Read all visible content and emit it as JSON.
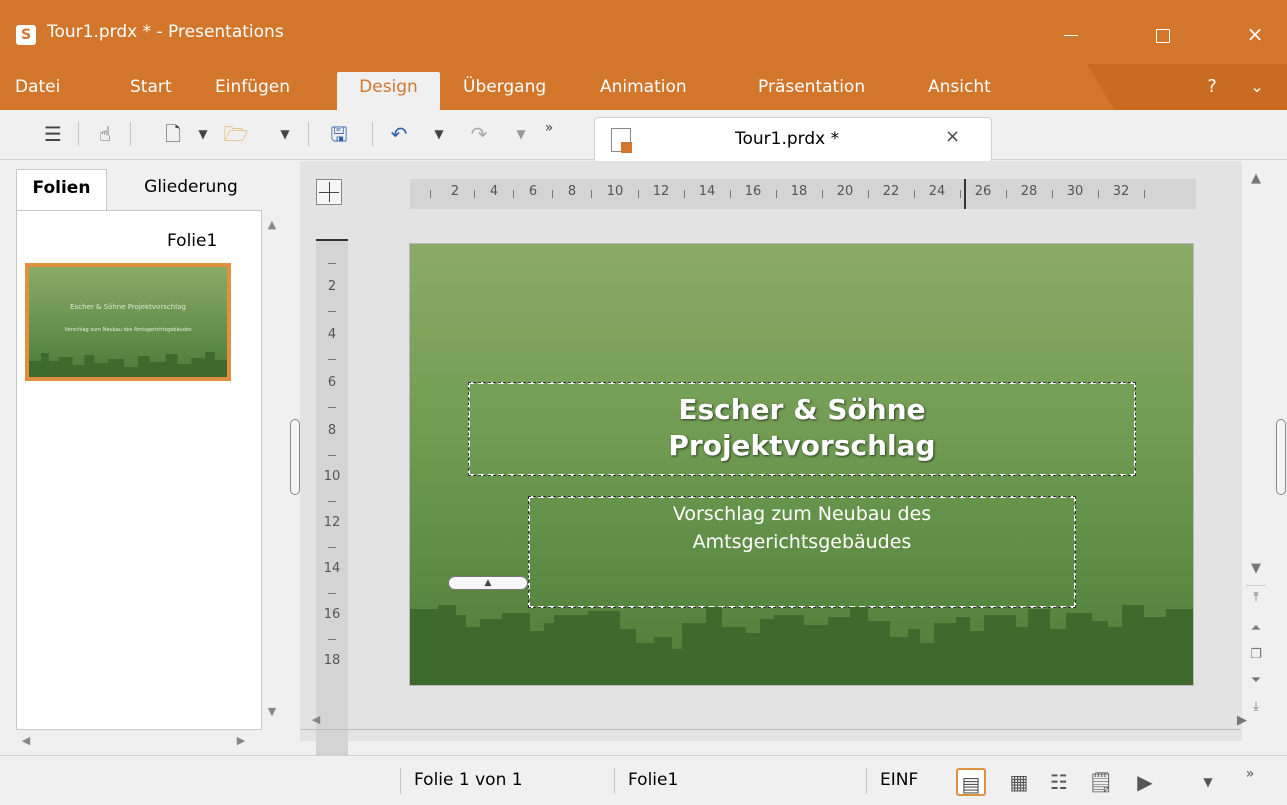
{
  "window": {
    "title": "Tour1.prdx * - Presentations",
    "logo_letter": "S",
    "minimize_icon": "minimize-icon",
    "maximize_icon": "maximize-icon",
    "close_icon": "×"
  },
  "menu": {
    "items": [
      {
        "label": "Datei"
      },
      {
        "label": "Start"
      },
      {
        "label": "Einfügen"
      },
      {
        "label": "Design",
        "active": true
      },
      {
        "label": "Übergang"
      },
      {
        "label": "Animation"
      },
      {
        "label": "Präsentation"
      },
      {
        "label": "Ansicht"
      }
    ],
    "help": "?",
    "collapse": "⌄",
    "accent_color": "#d2762b"
  },
  "toolbar": {
    "more": "»",
    "icons": [
      "menu-icon",
      "touch-mode-icon",
      "new-document-icon",
      "open-folder-icon",
      "save-icon",
      "undo-icon",
      "redo-icon"
    ]
  },
  "doc_tab": {
    "label": "Tour1.prdx *",
    "close": "×"
  },
  "left_panel": {
    "tabs": [
      {
        "label": "Folien",
        "active": true
      },
      {
        "label": "Gliederung"
      }
    ],
    "slide_label": "Folie1",
    "thumb_title": "Escher & Söhne Projektvorschlag",
    "thumb_subtitle": "Vorschlag zum Neubau des Amtsgerichtsgebäudes"
  },
  "rulers": {
    "horizontal": [
      "2",
      "4",
      "6",
      "8",
      "10",
      "12",
      "14",
      "16",
      "18",
      "20",
      "22",
      "24",
      "26",
      "28",
      "30",
      "32"
    ],
    "vertical": [
      "2",
      "4",
      "6",
      "8",
      "10",
      "12",
      "14",
      "16",
      "18"
    ]
  },
  "slide": {
    "title_line1": "Escher & Söhne",
    "title_line2": "Projektvorschlag",
    "subtitle_line1": "Vorschlag zum Neubau des",
    "subtitle_line2": "Amtsgerichtsgebäudes",
    "bg_top": "#8aab68",
    "bg_bottom": "#4c7d38",
    "skyline_color": "#3f6a2e"
  },
  "statusbar": {
    "slide_pos": "Folie 1 von 1",
    "slide_name": "Folie1",
    "mode": "EINF",
    "more": "»"
  }
}
